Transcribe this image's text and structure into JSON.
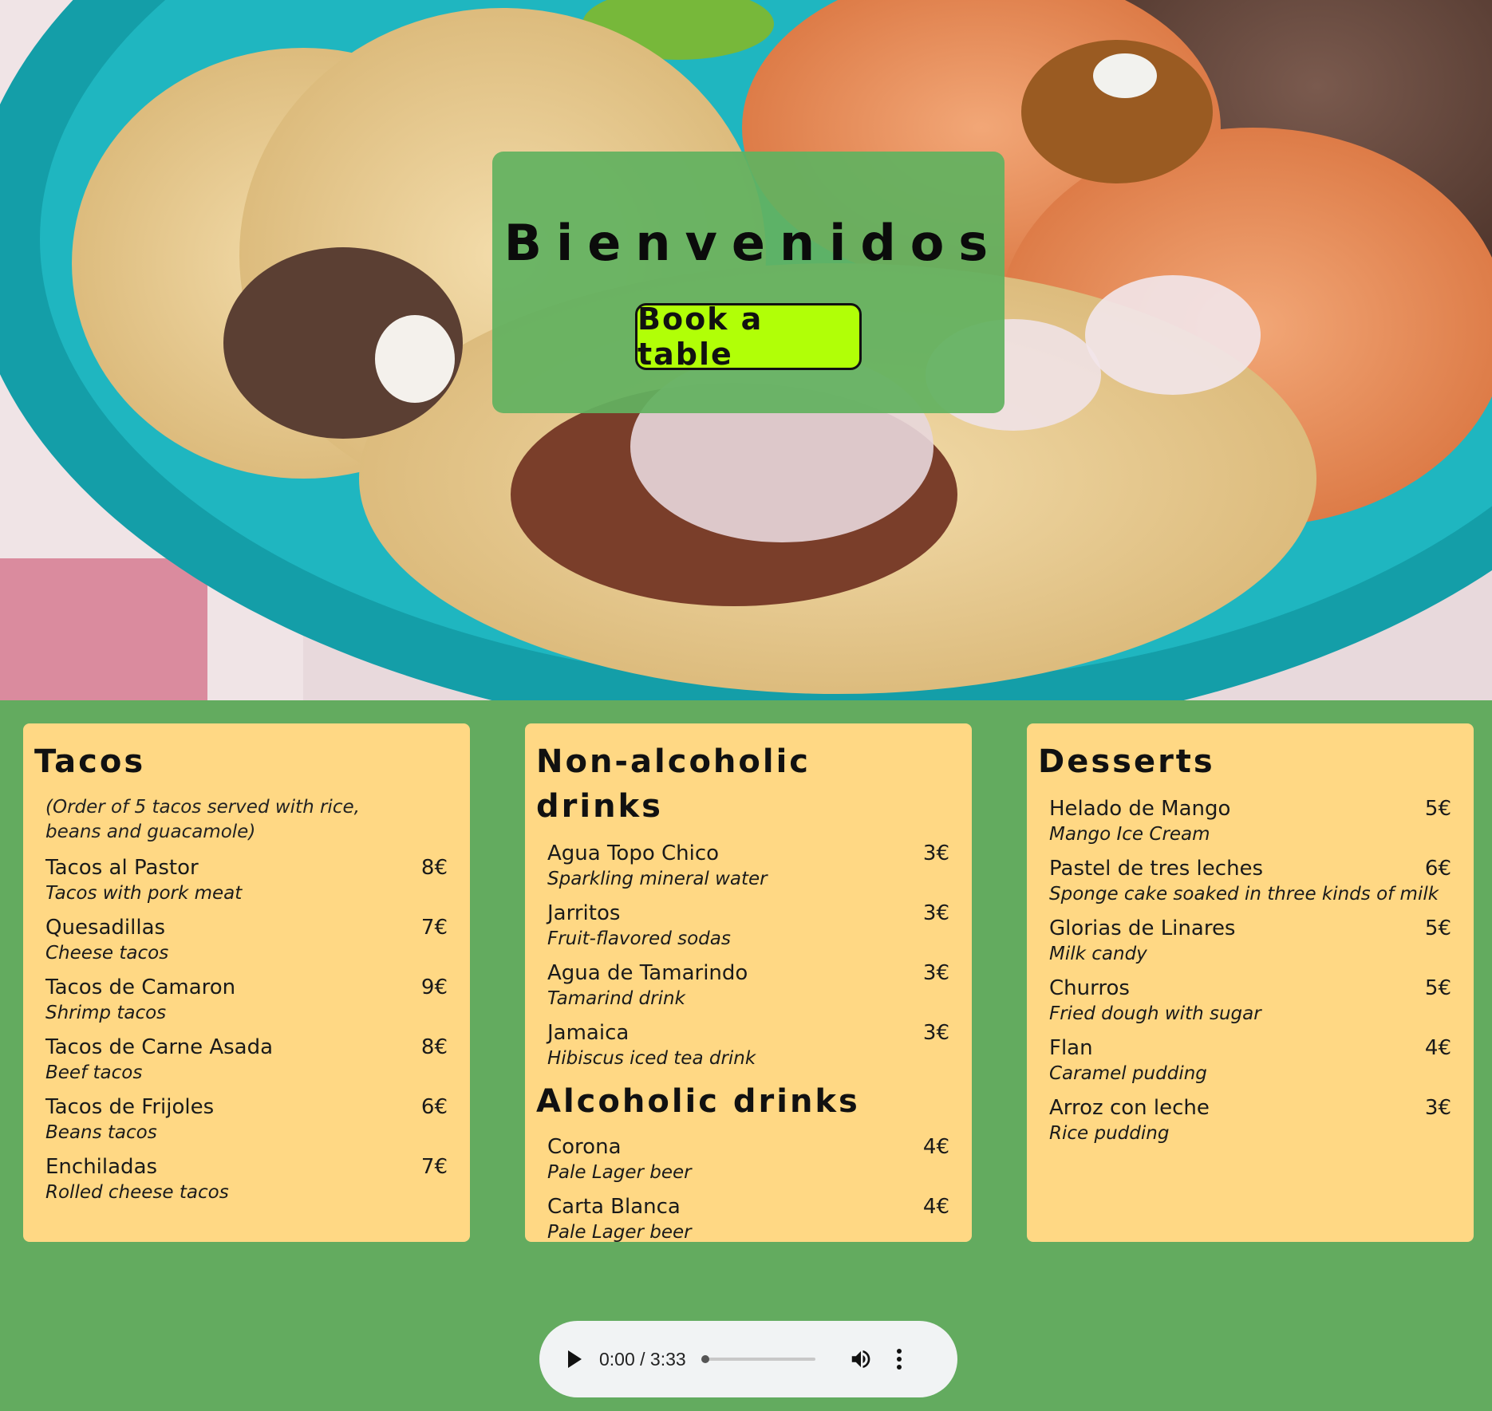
{
  "hero": {
    "title": "Bienvenidos",
    "button_label": "Book a table"
  },
  "menus": {
    "tacos": {
      "title": "Tacos",
      "note": "(Order of 5 tacos served with rice, beans and guacamole)",
      "items": [
        {
          "name": "Tacos al Pastor",
          "desc": "Tacos with pork meat",
          "price": "8€"
        },
        {
          "name": "Quesadillas",
          "desc": "Cheese tacos",
          "price": "7€"
        },
        {
          "name": "Tacos de Camaron",
          "desc": "Shrimp tacos",
          "price": "9€"
        },
        {
          "name": "Tacos de Carne Asada",
          "desc": "Beef tacos",
          "price": "8€"
        },
        {
          "name": "Tacos de Frijoles",
          "desc": "Beans tacos",
          "price": "6€"
        },
        {
          "name": "Enchiladas",
          "desc": "Rolled cheese tacos",
          "price": "7€"
        }
      ]
    },
    "nonalcoholic": {
      "title": "Non-alcoholic drinks",
      "items": [
        {
          "name": "Agua Topo Chico",
          "desc": "Sparkling mineral water",
          "price": "3€"
        },
        {
          "name": "Jarritos",
          "desc": "Fruit-flavored sodas",
          "price": "3€"
        },
        {
          "name": "Agua de Tamarindo",
          "desc": "Tamarind drink",
          "price": "3€"
        },
        {
          "name": "Jamaica",
          "desc": "Hibiscus iced tea drink",
          "price": "3€"
        }
      ]
    },
    "alcoholic": {
      "title": "Alcoholic drinks",
      "items": [
        {
          "name": "Corona",
          "desc": "Pale Lager beer",
          "price": "4€"
        },
        {
          "name": "Carta Blanca",
          "desc": "Pale Lager beer",
          "price": "4€"
        }
      ]
    },
    "desserts": {
      "title": "Desserts",
      "items": [
        {
          "name": "Helado de Mango",
          "desc": "Mango Ice Cream",
          "price": "5€"
        },
        {
          "name": "Pastel de tres leches",
          "desc": "Sponge cake soaked in three kinds of milk",
          "price": "6€"
        },
        {
          "name": "Glorias de Linares",
          "desc": "Milk candy",
          "price": "5€"
        },
        {
          "name": "Churros",
          "desc": "Fried dough with sugar",
          "price": "5€"
        },
        {
          "name": "Flan",
          "desc": "Caramel pudding",
          "price": "4€"
        },
        {
          "name": "Arroz con leche",
          "desc": "Rice pudding",
          "price": "3€"
        }
      ]
    }
  },
  "audio": {
    "time": "0:00 / 3:33",
    "progress": 0,
    "icons": [
      "play-icon",
      "volume-icon",
      "more-options-icon"
    ]
  },
  "colors": {
    "page_background": "#63ab5f",
    "card_background": "#ffd884",
    "welcome_box": "#62b260",
    "button_background": "#b1ff07"
  }
}
